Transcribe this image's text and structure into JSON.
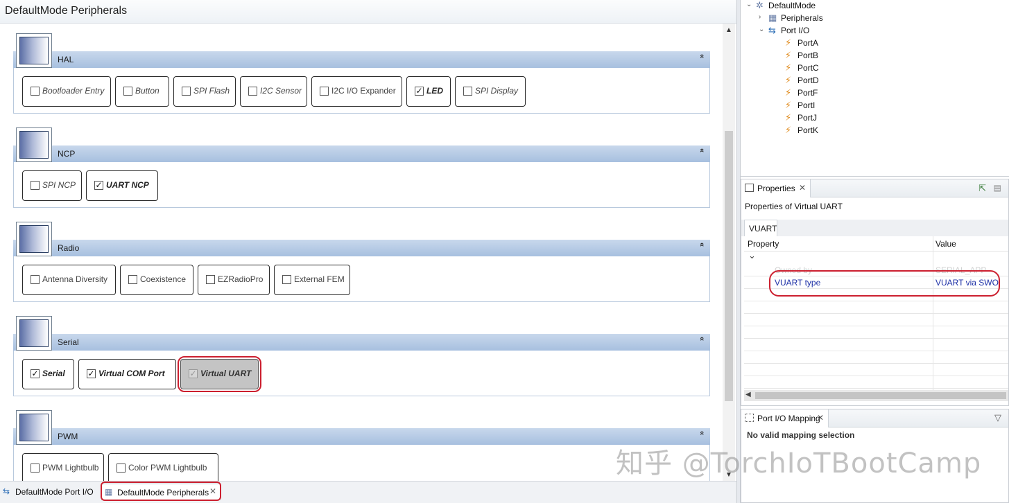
{
  "editor": {
    "title": "DefaultMode Peripherals",
    "sections": [
      {
        "name": "HAL",
        "modules": [
          {
            "label": "Bootloader Entry",
            "checked": false
          },
          {
            "label": "Button",
            "checked": false
          },
          {
            "label": "SPI Flash",
            "checked": false
          },
          {
            "label": "I2C Sensor",
            "checked": false
          },
          {
            "label": "I2C I/O Expander",
            "checked": false
          },
          {
            "label": "LED",
            "checked": true
          },
          {
            "label": "SPI Display",
            "checked": false
          }
        ]
      },
      {
        "name": "NCP",
        "modules": [
          {
            "label": "SPI NCP",
            "checked": false
          },
          {
            "label": "UART NCP",
            "checked": true
          }
        ]
      },
      {
        "name": "Radio",
        "modules": [
          {
            "label": "Antenna Diversity",
            "checked": false
          },
          {
            "label": "Coexistence",
            "checked": false
          },
          {
            "label": "EZRadioPro",
            "checked": false
          },
          {
            "label": "External FEM",
            "checked": false
          }
        ]
      },
      {
        "name": "Serial",
        "modules": [
          {
            "label": "Serial",
            "checked": true
          },
          {
            "label": "Virtual COM Port",
            "checked": true
          },
          {
            "label": "Virtual UART",
            "checked": true,
            "selected": true
          }
        ]
      },
      {
        "name": "PWM",
        "modules": [
          {
            "label": "PWM Lightbulb",
            "checked": false
          },
          {
            "label": "Color PWM Lightbulb",
            "checked": false
          }
        ]
      }
    ],
    "check_mark": "✓",
    "collapse_icon": "«",
    "scroll_up": "▲",
    "scroll_down": "▼"
  },
  "bottom_tabs": [
    {
      "label": "DefaultMode Port I/O",
      "icon": "port-io-icon",
      "active": false
    },
    {
      "label": "DefaultMode Peripherals",
      "icon": "peripherals-icon",
      "active": true,
      "close": "✕"
    }
  ],
  "outline": {
    "nodes": [
      {
        "label": "DefaultMode",
        "twisty": "⌄",
        "icon": "✲",
        "level": 0
      },
      {
        "label": "Peripherals",
        "twisty": "›",
        "icon": "▦",
        "level": 1
      },
      {
        "label": "Port I/O",
        "twisty": "⌄",
        "icon": "⇆",
        "level": 1
      },
      {
        "label": "PortA",
        "twisty": "",
        "icon": "⚡",
        "level": 2
      },
      {
        "label": "PortB",
        "twisty": "",
        "icon": "⚡",
        "level": 2
      },
      {
        "label": "PortC",
        "twisty": "",
        "icon": "⚡",
        "level": 2
      },
      {
        "label": "PortD",
        "twisty": "",
        "icon": "⚡",
        "level": 2
      },
      {
        "label": "PortF",
        "twisty": "",
        "icon": "⚡",
        "level": 2
      },
      {
        "label": "PortI",
        "twisty": "",
        "icon": "⚡",
        "level": 2
      },
      {
        "label": "PortJ",
        "twisty": "",
        "icon": "⚡",
        "level": 2
      },
      {
        "label": "PortK",
        "twisty": "",
        "icon": "⚡",
        "level": 2
      }
    ]
  },
  "properties": {
    "tab_label": "Properties",
    "close": "✕",
    "subtitle": "Properties of Virtual UART",
    "inner_tab": "VUART",
    "col_property": "Property",
    "col_value": "Value",
    "group_twisty": "⌄",
    "rows": [
      {
        "property": "Owned by",
        "value": "SERIAL_APP",
        "faded": true
      },
      {
        "property": "VUART type",
        "value": "VUART via SWO",
        "faded": false
      }
    ],
    "scroll_left": "◀"
  },
  "port_io_mapping": {
    "tab_label": "Port I/O Mapping",
    "close": "✕",
    "message": "No valid mapping selection",
    "filter_icon": "▽"
  },
  "watermark": "知乎 @TorchIoTBootCamp",
  "colors": {
    "section_header": "#a7c0df",
    "highlight_ring": "#cc1f2f",
    "property_text": "#1c2fa6"
  }
}
